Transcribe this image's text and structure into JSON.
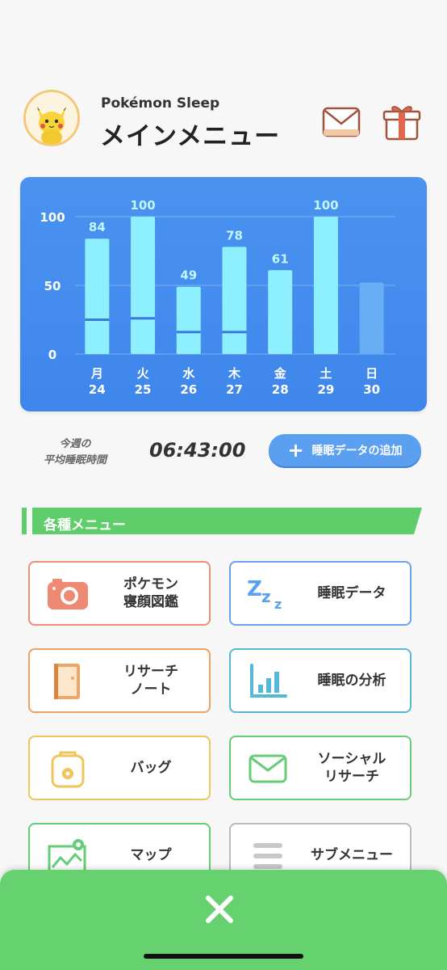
{
  "header": {
    "app_name": "Pokémon Sleep",
    "title": "メインメニュー",
    "avatar_icon": "pikachu-avatar",
    "mail_icon": "mail-icon",
    "gift_icon": "gift-icon"
  },
  "chart_data": {
    "type": "bar",
    "categories": [
      "月",
      "火",
      "水",
      "木",
      "金",
      "土",
      "日"
    ],
    "dates": [
      "24",
      "25",
      "26",
      "27",
      "28",
      "29",
      "30"
    ],
    "values": [
      84,
      100,
      49,
      78,
      61,
      100,
      52
    ],
    "labels": [
      "84",
      "100",
      "49",
      "78",
      "61",
      "100",
      ""
    ],
    "inner_marker": [
      25,
      26,
      16,
      16,
      null,
      null,
      null
    ],
    "yticks": [
      "100",
      "50",
      "0"
    ],
    "ylim": [
      0,
      100
    ],
    "grid": true,
    "colors": {
      "bar": "#8eefff",
      "bar_faded": "#67aef5",
      "marker": "#3a78e0",
      "grid": "#7cb0f2"
    }
  },
  "summary": {
    "label": "今週の\n平均睡眠時間",
    "value": "06:43:00",
    "add_button": "睡眠データの追加"
  },
  "section": {
    "title": "各種メニュー",
    "color": "#5fcd6a"
  },
  "menu": [
    {
      "label": "ポケモン\n寝顔図鑑",
      "icon": "camera-icon"
    },
    {
      "label": "睡眠データ",
      "icon": "zzz-icon"
    },
    {
      "label": "リサーチ\nノート",
      "icon": "notebook-icon"
    },
    {
      "label": "睡眠の分析",
      "icon": "bar-chart-icon"
    },
    {
      "label": "バッグ",
      "icon": "bag-icon"
    },
    {
      "label": "ソーシャル\nリサーチ",
      "icon": "envelope-icon"
    },
    {
      "label": "マップ",
      "icon": "map-icon"
    },
    {
      "label": "サブメニュー",
      "icon": "list-menu-icon"
    }
  ],
  "bottom": {
    "close_icon": "close-icon"
  }
}
